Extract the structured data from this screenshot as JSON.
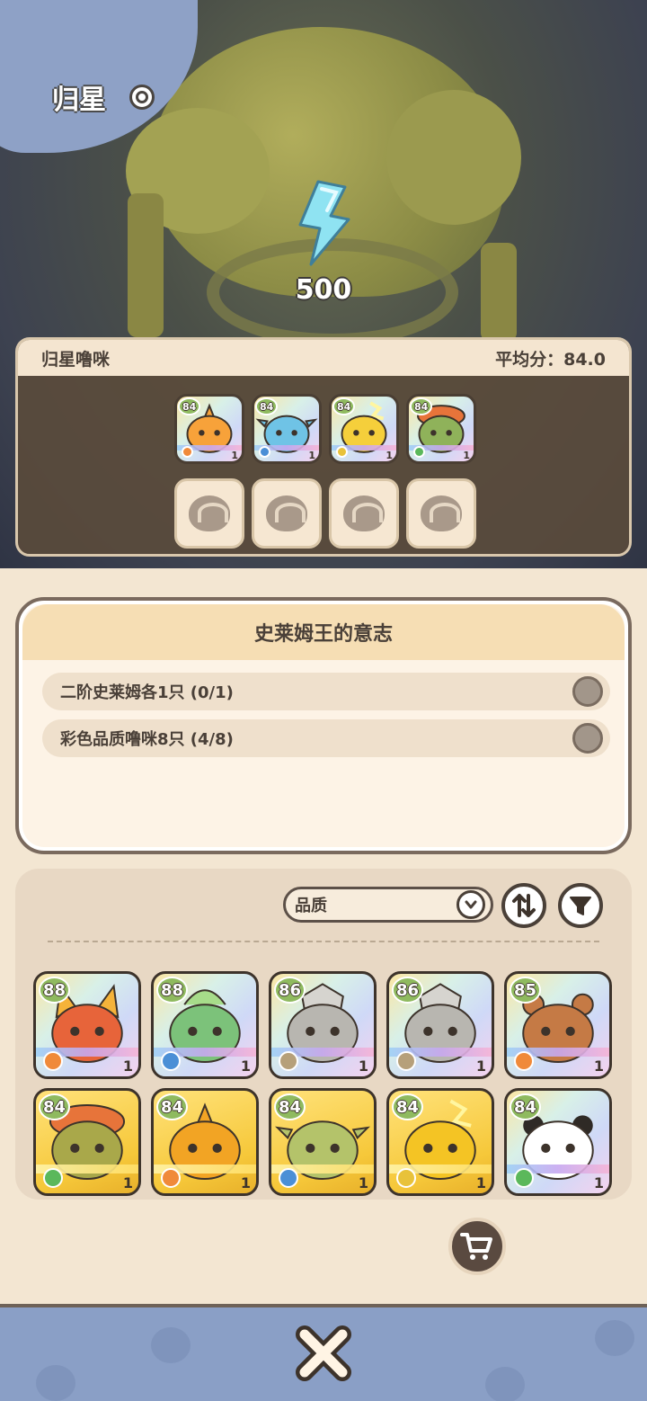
{
  "header": {
    "title": "归星"
  },
  "scene": {
    "energy_value": "500"
  },
  "team": {
    "name": "归星噜咪",
    "score_label": "平均分：84.0",
    "members": [
      {
        "level": "84",
        "stars": "1",
        "element": "fire",
        "color": "#f7a23a"
      },
      {
        "level": "84",
        "stars": "1",
        "element": "water",
        "color": "#6fc3e6"
      },
      {
        "level": "84",
        "stars": "1",
        "element": "thunder",
        "color": "#f5cf3b"
      },
      {
        "level": "84",
        "stars": "1",
        "element": "grass",
        "color": "#8fb25a"
      }
    ]
  },
  "mission": {
    "title": "史莱姆王的意志",
    "conditions": [
      {
        "text": "二阶史莱姆各1只 (0/1)"
      },
      {
        "text": "彩色品质噜咪8只 (4/8)"
      }
    ]
  },
  "collection": {
    "sort_label": "品质",
    "cards": [
      {
        "level": "88",
        "stars": "1",
        "style": "rainbow",
        "element": "fire",
        "creature": "fox-beast",
        "color": "#e7643a"
      },
      {
        "level": "88",
        "stars": "1",
        "style": "rainbow",
        "element": "water",
        "creature": "plant-spirit",
        "color": "#7cc27a"
      },
      {
        "level": "86",
        "stars": "1",
        "style": "rainbow",
        "element": "rock",
        "creature": "armored-knight",
        "color": "#b8b6b0"
      },
      {
        "level": "86",
        "stars": "1",
        "style": "rainbow",
        "element": "rock",
        "creature": "armored-knight",
        "color": "#b8b6b0"
      },
      {
        "level": "85",
        "stars": "1",
        "style": "rainbow",
        "element": "fire",
        "creature": "bear",
        "color": "#c57a45"
      },
      {
        "level": "84",
        "stars": "1",
        "style": "gold",
        "element": "grass",
        "creature": "mushroom-slime",
        "color": "#a9a84a"
      },
      {
        "level": "84",
        "stars": "1",
        "style": "gold",
        "element": "fire",
        "creature": "fire-slime",
        "color": "#f2a424"
      },
      {
        "level": "84",
        "stars": "1",
        "style": "gold",
        "element": "water",
        "creature": "water-slime",
        "color": "#b4c36a"
      },
      {
        "level": "84",
        "stars": "1",
        "style": "gold",
        "element": "thunder",
        "creature": "thunder-slime",
        "color": "#f4c424"
      },
      {
        "level": "84",
        "stars": "1",
        "style": "rainbow",
        "element": "grass",
        "creature": "panda",
        "color": "#ffffff"
      }
    ]
  },
  "icons": {
    "info": "info-icon",
    "energy": "lightning-crystal-icon",
    "order": "sort-order-icon",
    "filter": "filter-icon",
    "cart": "cart-icon",
    "close": "close-icon",
    "dropdown": "chevron-down-icon"
  }
}
